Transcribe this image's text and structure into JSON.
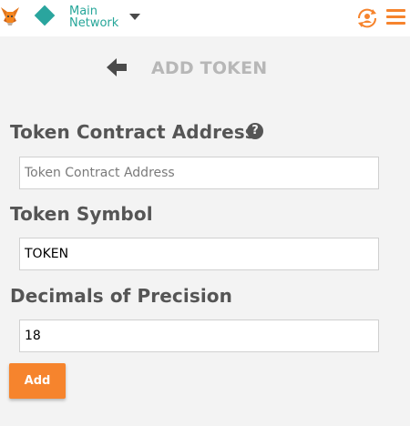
{
  "header": {
    "network": {
      "name": "Main Network"
    },
    "icons": {
      "logo": "metamask-fox-icon",
      "network": "network-diamond-icon",
      "dropdown": "chevron-down-icon",
      "account": "account-switch-icon",
      "menu": "hamburger-menu-icon"
    }
  },
  "page": {
    "title": "ADD TOKEN",
    "back_icon": "arrow-left-icon"
  },
  "form": {
    "contract_address": {
      "label": "Token Contract Address",
      "help_icon": "question-circle-icon",
      "help_glyph": "?",
      "value": "",
      "placeholder": "Token Contract Address"
    },
    "symbol": {
      "label": "Token Symbol",
      "value": "TOKEN",
      "placeholder": ""
    },
    "decimals": {
      "label": "Decimals of Precision",
      "value": "18",
      "placeholder": ""
    },
    "submit_label": "Add"
  },
  "colors": {
    "accent": "#f6842d",
    "network": "#2aa59e",
    "background": "#f3f3f3",
    "title": "#b7b7b7"
  }
}
